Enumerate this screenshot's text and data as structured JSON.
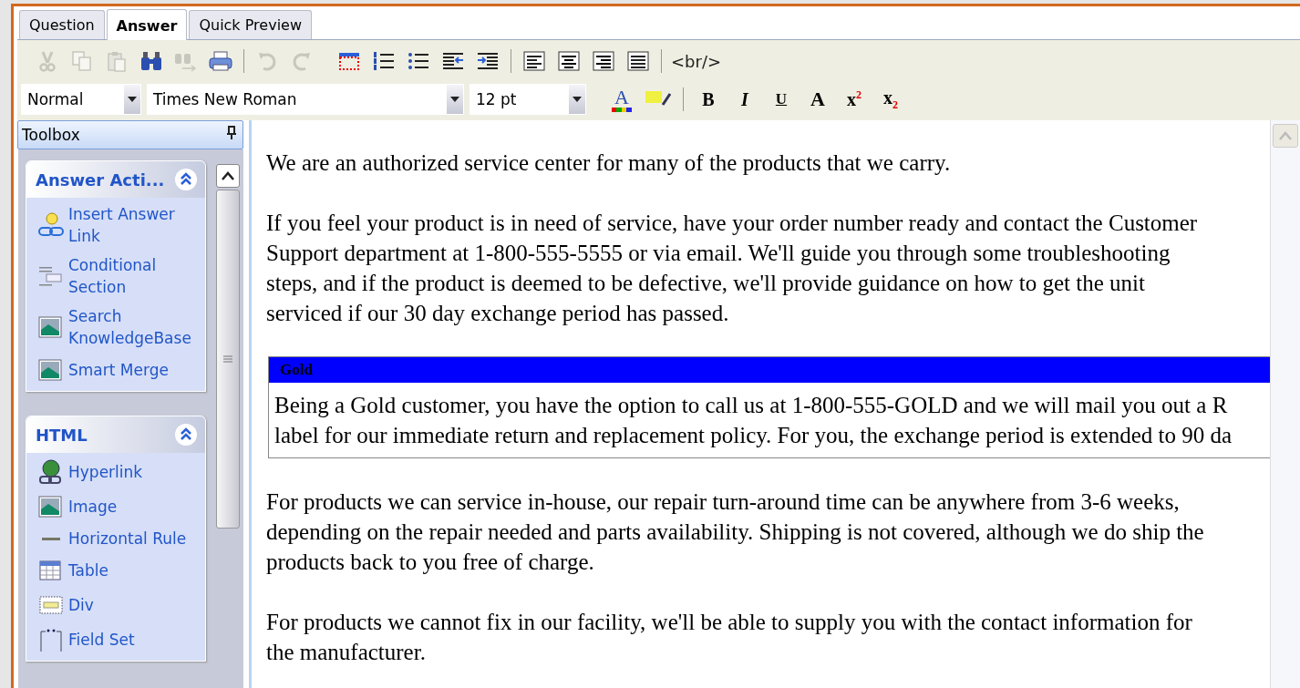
{
  "tabs": [
    {
      "label": "Question",
      "selected": false
    },
    {
      "label": "Answer",
      "selected": true
    },
    {
      "label": "Quick Preview",
      "selected": false
    }
  ],
  "toolbar_1": [
    {
      "kind": "cut",
      "disabled": true
    },
    {
      "kind": "copy",
      "disabled": true
    },
    {
      "kind": "paste",
      "disabled": true
    },
    {
      "kind": "find",
      "disabled": false
    },
    {
      "kind": "find-next",
      "disabled": true
    },
    {
      "kind": "print",
      "disabled": false
    },
    {
      "kind": "sep"
    },
    {
      "kind": "undo",
      "disabled": true
    },
    {
      "kind": "redo",
      "disabled": true
    },
    {
      "kind": "gap"
    },
    {
      "kind": "borders",
      "disabled": false
    },
    {
      "kind": "numbered-list",
      "disabled": false
    },
    {
      "kind": "bullet-list",
      "disabled": false
    },
    {
      "kind": "outdent",
      "disabled": false
    },
    {
      "kind": "indent",
      "disabled": false
    },
    {
      "kind": "sep"
    },
    {
      "kind": "align-left",
      "disabled": false
    },
    {
      "kind": "align-center",
      "disabled": false
    },
    {
      "kind": "align-right",
      "disabled": false
    },
    {
      "kind": "justify",
      "disabled": false
    },
    {
      "kind": "sep"
    },
    {
      "kind": "text",
      "label": "<br/>",
      "disabled": false
    }
  ],
  "format_bar": {
    "style": "Normal",
    "font": "Times New Roman",
    "size": "12 pt"
  },
  "toolbar_2": [
    {
      "kind": "font-color",
      "label": "A"
    },
    {
      "kind": "highlight"
    },
    {
      "kind": "sep"
    },
    {
      "kind": "bold",
      "label": "B"
    },
    {
      "kind": "italic",
      "label": "I"
    },
    {
      "kind": "underline",
      "label": "U"
    },
    {
      "kind": "font",
      "label": "A"
    },
    {
      "kind": "superscript",
      "label": "x$^{2}$"
    },
    {
      "kind": "subscript",
      "label": "x$_{2}$"
    }
  ],
  "toolbox": {
    "title": "Toolbox",
    "groups": [
      {
        "title": "Answer Acti...",
        "expanded": true,
        "items": [
          {
            "label": "Insert Answer Link",
            "kind": "link"
          },
          {
            "label": "Conditional Section",
            "kind": "section"
          },
          {
            "label": "Search KnowledgeBase",
            "kind": "image"
          },
          {
            "label": "Smart Merge",
            "kind": "image"
          }
        ]
      },
      {
        "title": "HTML",
        "expanded": true,
        "items": [
          {
            "label": "Hyperlink",
            "kind": "globe"
          },
          {
            "label": "Image",
            "kind": "image"
          },
          {
            "label": "Horizontal Rule",
            "kind": "rule"
          },
          {
            "label": "Table",
            "kind": "table"
          },
          {
            "label": "Div",
            "kind": "div"
          },
          {
            "label": "Field Set",
            "kind": "fieldset"
          }
        ]
      }
    ]
  },
  "document": [
    {
      "kind": "paragraph",
      "lines": [
        "We are an authorized service center for many of the products that we carry."
      ]
    },
    {
      "kind": "paragraph",
      "lines": [
        "If you feel your product is in need of service, have your order number ready and contact the Customer",
        "Support department at 1-800-555-5555 or via email. We'll guide you through some troubleshooting",
        "steps, and if the product is deemed to be defective, we'll provide guidance on how to get the unit",
        "serviced if our 30 day exchange period has passed."
      ]
    },
    {
      "kind": "conditional",
      "title": "Gold",
      "lines": [
        "Being a Gold customer, you have the option to call us at 1-800-555-GOLD and we will mail you out a R",
        "label for our immediate return and replacement policy. For you, the exchange period is extended to 90 da"
      ]
    },
    {
      "kind": "paragraph",
      "lines": [
        "For products we can service in-house, our repair turn-around time can be anywhere from 3-6 weeks,",
        "depending on the repair needed and parts availability.  Shipping is not covered, although we do ship the",
        "products back to you free of charge."
      ]
    },
    {
      "kind": "paragraph",
      "lines": [
        "For products we cannot fix in our facility, we'll be able to supply you with the contact information for",
        "the manufacturer."
      ]
    }
  ]
}
